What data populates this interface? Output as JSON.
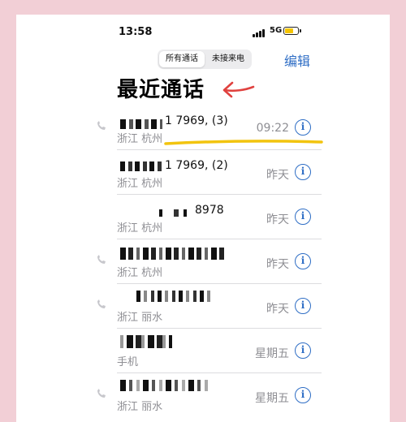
{
  "status_bar": {
    "time": "13:58",
    "network": "5G"
  },
  "segmented": {
    "tab_all": "所有通话",
    "tab_missed": "未接来电"
  },
  "header": {
    "edit": "编辑",
    "title": "最近通话"
  },
  "info_glyph": "i",
  "calls": [
    {
      "name": "1 7969, (3)",
      "location": "浙江 杭州",
      "when": "09:22"
    },
    {
      "name": "1 7969, (2)",
      "location": "浙江 杭州",
      "when": "昨天"
    },
    {
      "name": "8978",
      "location": "浙江 杭州",
      "when": "昨天"
    },
    {
      "name": "",
      "location": "浙江 杭州",
      "when": "昨天"
    },
    {
      "name": "",
      "location": "浙江 丽水",
      "when": "昨天"
    },
    {
      "name": "",
      "location": "手机",
      "when": "星期五"
    },
    {
      "name": "",
      "location": "浙江 丽水",
      "when": "星期五"
    }
  ],
  "colors": {
    "accent": "#2f6ec5",
    "annotation_arrow": "#e0423f",
    "annotation_underline": "#f2c40f",
    "background": "#f2cfd6"
  }
}
